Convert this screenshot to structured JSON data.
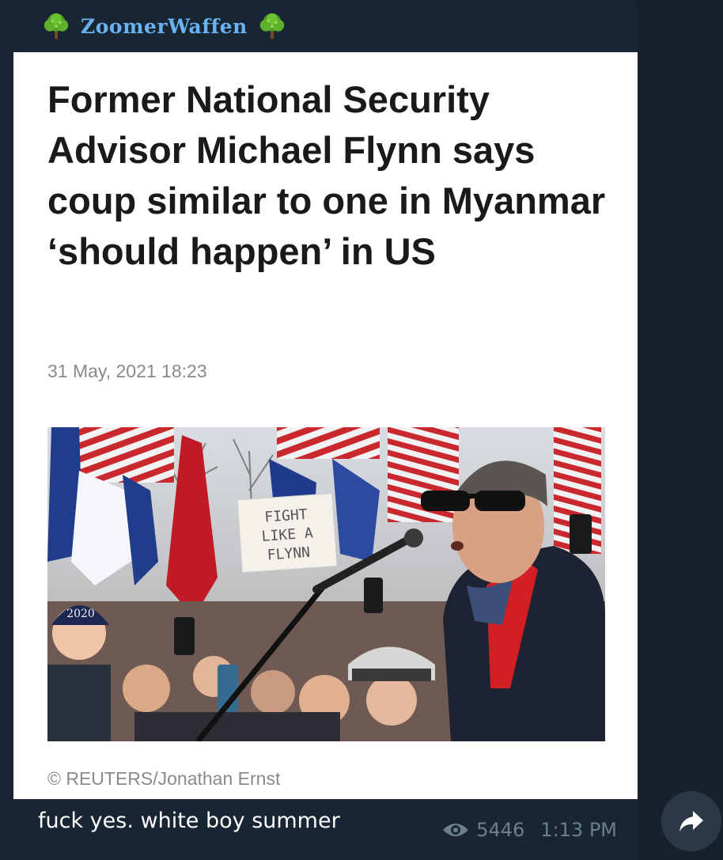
{
  "channel": {
    "name": "ZoomerWaffen",
    "left_icon": "tree-icon",
    "right_icon": "tree-icon"
  },
  "article": {
    "headline": "Former National Security Advisor Michael Flynn says coup similar to one in Myanmar ‘should happen’ in US",
    "date": "31 May, 2021 18:23",
    "photo_sign_text": "FIGHT LIKE A FLYNN",
    "photo_hat_text": "2020",
    "credit": "© REUTERS/Jonathan Ernst"
  },
  "message": {
    "text": "fuck yes. white boy summer",
    "views": "5446",
    "time": "1:13 PM",
    "views_icon": "eye-icon"
  },
  "actions": {
    "forward_icon": "forward-arrow-icon"
  },
  "colors": {
    "background": "#17212b",
    "bubble": "#182533",
    "channel_name": "#6ab2f2",
    "meta": "#6d7f8f"
  }
}
